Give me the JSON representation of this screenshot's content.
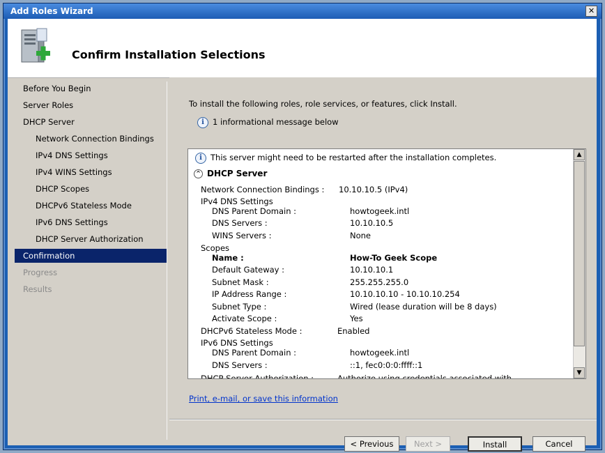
{
  "window": {
    "title": "Add Roles Wizard",
    "close_label": "✕"
  },
  "header": {
    "title": "Confirm Installation Selections"
  },
  "nav": {
    "items": [
      {
        "label": "Before You Begin"
      },
      {
        "label": "Server Roles"
      },
      {
        "label": "DHCP Server"
      },
      {
        "label": "Network Connection Bindings"
      },
      {
        "label": "IPv4 DNS Settings"
      },
      {
        "label": "IPv4 WINS Settings"
      },
      {
        "label": "DHCP Scopes"
      },
      {
        "label": "DHCPv6 Stateless Mode"
      },
      {
        "label": "IPv6 DNS Settings"
      },
      {
        "label": "DHCP Server Authorization"
      },
      {
        "label": "Confirmation"
      },
      {
        "label": "Progress"
      },
      {
        "label": "Results"
      }
    ]
  },
  "content": {
    "intro": "To install the following roles, role services, or features, click Install.",
    "info_message": "1 informational message below",
    "link": "Print, e-mail, or save this information"
  },
  "panel": {
    "restart_notice": "This server might need to be restarted after the installation completes.",
    "section_title": "DHCP Server",
    "rows": [
      {
        "label": "Network Connection Bindings :",
        "value": "10.10.10.5 (IPv4)"
      },
      {
        "label": "IPv4 DNS Settings",
        "value": ""
      },
      {
        "label": "DNS Parent Domain :",
        "value": "howtogeek.intl"
      },
      {
        "label": "DNS Servers :",
        "value": "10.10.10.5"
      },
      {
        "label": "WINS Servers :",
        "value": "None"
      },
      {
        "label": "Scopes",
        "value": ""
      },
      {
        "label": "Name :",
        "value": "How-To Geek Scope"
      },
      {
        "label": "Default Gateway :",
        "value": "10.10.10.1"
      },
      {
        "label": "Subnet Mask :",
        "value": "255.255.255.0"
      },
      {
        "label": "IP Address Range :",
        "value": "10.10.10.10 - 10.10.10.254"
      },
      {
        "label": "Subnet Type :",
        "value": "Wired (lease duration will be 8 days)"
      },
      {
        "label": "Activate Scope :",
        "value": "Yes"
      },
      {
        "label": "DHCPv6 Stateless Mode :",
        "value": "Enabled"
      },
      {
        "label": "IPv6 DNS Settings",
        "value": ""
      },
      {
        "label": "DNS Parent Domain :",
        "value": "howtogeek.intl"
      },
      {
        "label": "DNS Servers :",
        "value": "::1, fec0:0:0:ffff::1"
      },
      {
        "label": "DHCP Server Authorization :",
        "value": "Authorize using credentials associated with"
      }
    ]
  },
  "buttons": {
    "previous": "< Previous",
    "next": "Next >",
    "install": "Install",
    "cancel": "Cancel"
  },
  "icons": {
    "info": "i",
    "collapse": "^",
    "scroll_up": "▲",
    "scroll_down": "▼"
  }
}
